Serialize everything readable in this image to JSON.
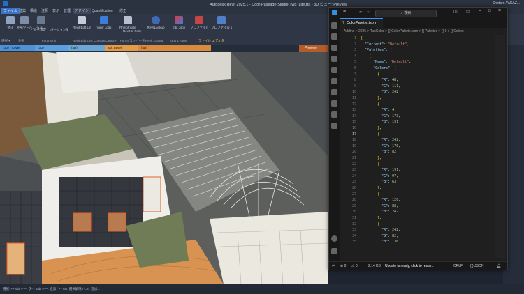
{
  "revit": {
    "title": "Autodesk Revit 2025.1 - Door-Passage-Single-Two_Lite.rfa - 3D ビュー: Preview",
    "user": "Shotaro.YAKAZ...",
    "tabs": [
      "ファイル",
      "建築",
      "構造",
      "注釈",
      "表示",
      "管理",
      "アドイン",
      "Quantification",
      "修正"
    ],
    "active_tab": "ファイル",
    "ribbon_buttons": [
      {
        "label": "修正",
        "icon": "cursor-icon"
      },
      {
        "label": "外部ツール",
        "icon": "tool-icon"
      },
      {
        "label": "ヘルプ",
        "icon": "help-icon"
      },
      {
        "label": "ビルを決定",
        "icon": "building-icon"
      },
      {
        "label": "バージョン情報",
        "icon": "info-icon"
      },
      {
        "label": "Revit Edit Link",
        "icon": "link-icon"
      },
      {
        "label": "View Logs",
        "icon": "logs-icon"
      },
      {
        "label": "RhinoInside",
        "icon": "rhino-icon"
      },
      {
        "label": "Revit to FormIt",
        "icon": "formit-icon"
      },
      {
        "label": "RevitLookup",
        "icon": "lookup-icon"
      },
      {
        "label": "Edit Json",
        "icon": "json-icon"
      },
      {
        "label": "プロファイル ロード",
        "icon": "profile-icon"
      },
      {
        "label": "プロファイル ロードして開始",
        "icon": "profile-start-icon"
      }
    ],
    "ribbon_groups": [
      "選択 ▾",
      "外部",
      "eTransmit",
      "Revit Edit Link",
      "ConsoleCapture",
      "FormItコンバータ",
      "Revit Lookup",
      "ZEN 1 Apps",
      "ファイル エディタ"
    ],
    "view_tabs": [
      {
        "label": "{3D} - Cover",
        "color": "#4d92d9"
      },
      {
        "label": "{3D}",
        "color": "#5aa0e0"
      },
      {
        "label": "{3D}",
        "color": "#6aa6d6"
      },
      {
        "label": "Sol. Level",
        "color": "#e59a45"
      },
      {
        "label": "{3D}",
        "color": "#d88a3e"
      }
    ],
    "preview_label": "Preview",
    "status_text": "選択: ++Tab キー: 次へ Tab キー: 追加 / ++Tab: 選択解除 / Ctrl: 追加..."
  },
  "vscode": {
    "search_placeholder": "検索",
    "tab_label": "ColorPalette.json",
    "breadcrumb": "Addins > 2025 > TabColor > {} ColorPalette.json > [] Palettes > {} 0 > [] Colors",
    "lines": [
      {
        "n": "1",
        "t": "{"
      },
      {
        "n": "2",
        "t": "  \"Current\": \"Default\","
      },
      {
        "n": "3",
        "t": "  \"Palettes\": ["
      },
      {
        "n": "4",
        "t": "    {"
      },
      {
        "n": "5",
        "t": "      \"Name\": \"Default\","
      },
      {
        "n": "6",
        "t": "      \"Colors\": ["
      },
      {
        "n": "7",
        "t": "        {"
      },
      {
        "n": "8",
        "t": "          \"R\": 48,"
      },
      {
        "n": "9",
        "t": "          \"G\": 111,"
      },
      {
        "n": "10",
        "t": "          \"B\": 242"
      },
      {
        "n": "11",
        "t": "        },"
      },
      {
        "n": "12",
        "t": "        {"
      },
      {
        "n": "13",
        "t": "          \"R\": 4,"
      },
      {
        "n": "14",
        "t": "          \"G\": 173,"
      },
      {
        "n": "15",
        "t": "          \"B\": 191"
      },
      {
        "n": "16",
        "t": "        },"
      },
      {
        "n": "17",
        "t": "        {"
      },
      {
        "n": "18",
        "t": "          \"R\": 242,"
      },
      {
        "n": "19",
        "t": "          \"G\": 170,"
      },
      {
        "n": "20",
        "t": "          \"B\": 82"
      },
      {
        "n": "21",
        "t": "        },"
      },
      {
        "n": "22",
        "t": "        {"
      },
      {
        "n": "23",
        "t": "          \"R\": 191,"
      },
      {
        "n": "24",
        "t": "          \"G\": 97,"
      },
      {
        "n": "25",
        "t": "          \"B\": 63"
      },
      {
        "n": "26",
        "t": "        },"
      },
      {
        "n": "27",
        "t": "        {"
      },
      {
        "n": "28",
        "t": "          \"R\": 120,"
      },
      {
        "n": "29",
        "t": "          \"G\": 88,"
      },
      {
        "n": "30",
        "t": "          \"B\": 242"
      },
      {
        "n": "31",
        "t": "        },"
      },
      {
        "n": "32",
        "t": "        {"
      },
      {
        "n": "33",
        "t": "          \"R\": 242,"
      },
      {
        "n": "34",
        "t": "          \"G\": 82,"
      },
      {
        "n": "35",
        "t": "          \"B\": 136"
      }
    ],
    "status": {
      "errors": "⊗ 0",
      "warnings": "⚠ 0",
      "size": "2.14 KB",
      "update": "Update is ready, click to restart.",
      "eol": "CRLF",
      "lang": "{ } JSON"
    }
  }
}
